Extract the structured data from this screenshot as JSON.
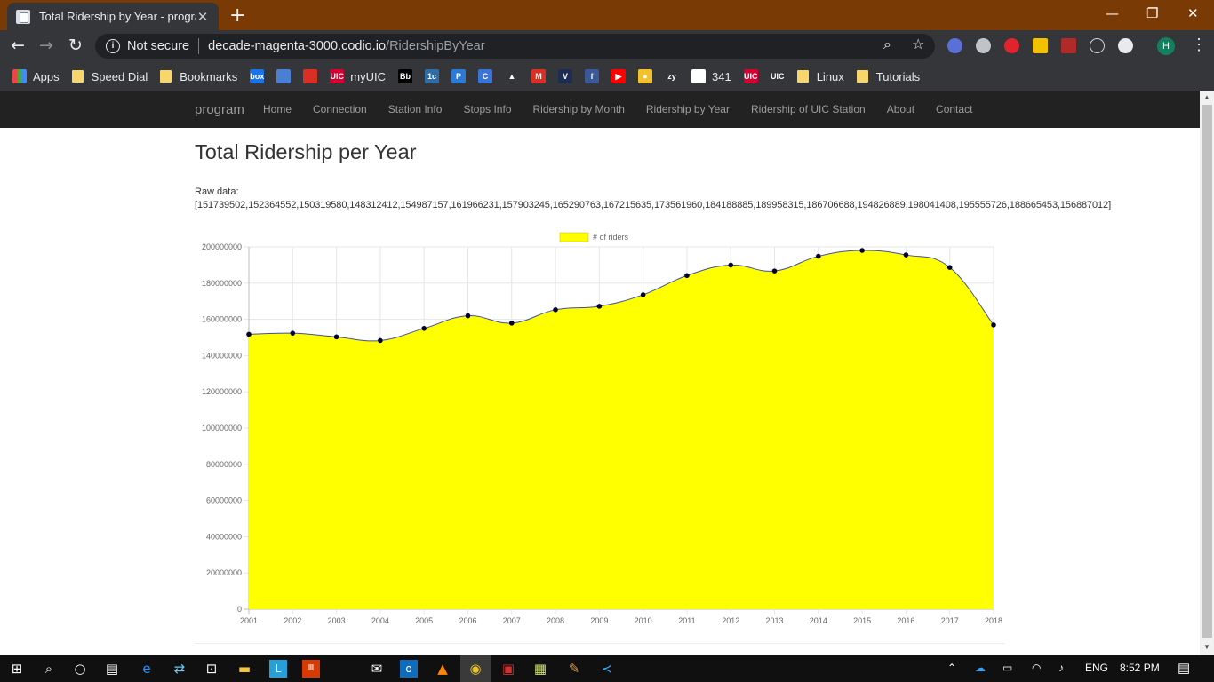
{
  "browser": {
    "tab_title": "Total Ridership by Year - program",
    "tab_close": "✕",
    "new_tab": "+",
    "window_controls": {
      "minimize": "—",
      "maximize": "❐",
      "close": "✕"
    },
    "omnibox": {
      "security": "Not secure",
      "host": "decade-magenta-3000.codio.io",
      "path": "/RidershipByYear"
    },
    "profile_initial": "H"
  },
  "bookmarks": [
    {
      "label": "Apps",
      "icon": "apps-grid-icon"
    },
    {
      "label": "Speed Dial",
      "icon": "folder-icon"
    },
    {
      "label": "Bookmarks",
      "icon": "folder-icon"
    },
    {
      "label": "",
      "icon": "box-icon",
      "icon_text": "box",
      "color": "#1a73e8"
    },
    {
      "label": "",
      "icon": "blue-square-icon",
      "icon_text": "",
      "color": "#4a7fd4"
    },
    {
      "label": "",
      "icon": "red-circle-icon",
      "icon_text": "",
      "color": "#d93025"
    },
    {
      "label": "myUIC",
      "icon": "uic-icon",
      "icon_text": "UIC",
      "color": "#d50032"
    },
    {
      "label": "",
      "icon": "blackboard-icon",
      "icon_text": "Bb",
      "color": "#000000"
    },
    {
      "label": "",
      "icon": "tc-icon",
      "icon_text": "1c",
      "color": "#2f6ea5"
    },
    {
      "label": "",
      "icon": "p-icon",
      "icon_text": "P",
      "color": "#2b7bd6"
    },
    {
      "label": "",
      "icon": "c-icon",
      "icon_text": "C",
      "color": "#3b73d6"
    },
    {
      "label": "",
      "icon": "drive-icon",
      "icon_text": "▲",
      "color": "#35363a"
    },
    {
      "label": "",
      "icon": "gmail-icon",
      "icon_text": "M",
      "color": "#d93025"
    },
    {
      "label": "",
      "icon": "v-icon",
      "icon_text": "V",
      "color": "#1d2d52"
    },
    {
      "label": "",
      "icon": "facebook-icon",
      "icon_text": "f",
      "color": "#3b5998"
    },
    {
      "label": "",
      "icon": "youtube-icon",
      "icon_text": "▶",
      "color": "#ff0000"
    },
    {
      "label": "",
      "icon": "duck-icon",
      "icon_text": "●",
      "color": "#f2c12e"
    },
    {
      "label": "",
      "icon": "zy-icon",
      "icon_text": "zy",
      "color": "#35363a"
    },
    {
      "label": "341",
      "icon": "globe-icon",
      "icon_text": "◐",
      "color": "#ffffff"
    },
    {
      "label": "",
      "icon": "uic-red-icon",
      "icon_text": "UIC",
      "color": "#d50032"
    },
    {
      "label": "",
      "icon": "uic-outline-icon",
      "icon_text": "UIC",
      "color": "#35363a"
    },
    {
      "label": "Linux",
      "icon": "folder-icon"
    },
    {
      "label": "Tutorials",
      "icon": "folder-icon"
    }
  ],
  "site": {
    "brand": "program",
    "nav": [
      "Home",
      "Connection",
      "Station Info",
      "Stops Info",
      "Ridership by Month",
      "Ridership by Year",
      "Ridership of UIC Station",
      "About",
      "Contact"
    ],
    "title": "Total Ridership per Year",
    "raw_label": "Raw data:",
    "raw_values": "[151739502,152364552,150319580,148312412,154987157,161966231,157903245,165290763,167215635,173561960,184188885,189958315,186706688,194826889,198041408,195555726,188665453,156887012]"
  },
  "chart_data": {
    "type": "area",
    "title": "",
    "xlabel": "",
    "ylabel": "",
    "legend": "top-center",
    "categories": [
      "2001",
      "2002",
      "2003",
      "2004",
      "2005",
      "2006",
      "2007",
      "2008",
      "2009",
      "2010",
      "2011",
      "2012",
      "2013",
      "2014",
      "2015",
      "2016",
      "2017",
      "2018"
    ],
    "series": [
      {
        "name": "# of riders",
        "fill": "#ffff00",
        "line": "#3e4ea8",
        "point": "#000033",
        "values": [
          151739502,
          152364552,
          150319580,
          148312412,
          154987157,
          161966231,
          157903245,
          165290763,
          167215635,
          173561960,
          184188885,
          189958315,
          186706688,
          194826889,
          198041408,
          195555726,
          188665453,
          156887012
        ]
      }
    ],
    "ylim": [
      0,
      200000000
    ],
    "yticks": [
      "0",
      "20000000",
      "40000000",
      "60000000",
      "80000000",
      "100000000",
      "120000000",
      "140000000",
      "160000000",
      "180000000",
      "200000000"
    ],
    "grid": true
  },
  "taskbar": {
    "language": "ENG",
    "time": "8:52 PM"
  }
}
